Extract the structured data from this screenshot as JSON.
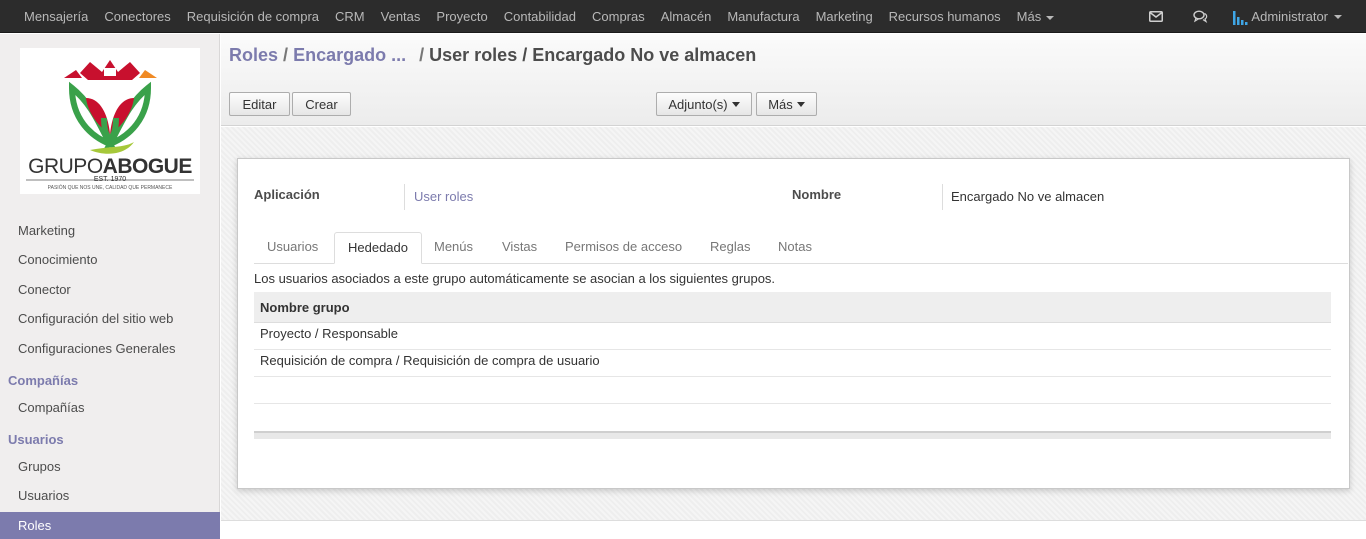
{
  "topnav": {
    "items": [
      "Mensajería",
      "Conectores",
      "Requisición de compra",
      "CRM",
      "Ventas",
      "Proyecto",
      "Contabilidad",
      "Compras",
      "Almacén",
      "Manufactura",
      "Marketing",
      "Recursos humanos"
    ],
    "more_label": "Más",
    "user_name": "Administrator",
    "icons": [
      "envelope-icon",
      "chat-icon",
      "user-avatar-icon"
    ]
  },
  "logo": {
    "brand_left": "GRUPO",
    "brand_right": "ABOGUE",
    "est": "EST. 1970",
    "tagline": "PASIÓN QUE NOS UNE, CALIDAD QUE PERMANECE",
    "colors": {
      "green": "#3aa14a",
      "red": "#c8102e",
      "orange": "#f08a24"
    }
  },
  "sidebar": {
    "items_top": [
      "Marketing",
      "Conocimiento",
      "Conector",
      "Configuración del sitio web",
      "Configuraciones Generales"
    ],
    "heading_companies": "Compañías",
    "companies": [
      "Compañías"
    ],
    "heading_users": "Usuarios",
    "users": [
      "Grupos",
      "Usuarios"
    ],
    "active_item": "Roles"
  },
  "breadcrumb": {
    "root": "Roles",
    "parent": "Encargado ...",
    "current": "User roles / Encargado No ve almacen"
  },
  "toolbar": {
    "edit_label": "Editar",
    "create_label": "Crear",
    "attachments_label": "Adjunto(s)",
    "more_label": "Más"
  },
  "form": {
    "application_label": "Aplicación",
    "application_value": "User roles",
    "name_label": "Nombre",
    "name_value": "Encargado No ve almacen"
  },
  "tabs": [
    "Usuarios",
    "Hededado",
    "Menús",
    "Vistas",
    "Permisos de acceso",
    "Reglas",
    "Notas"
  ],
  "active_tab": "Hededado",
  "inherited": {
    "note": "Los usuarios asociados a este grupo automáticamente se asocian a los siguientes grupos.",
    "column_header": "Nombre grupo",
    "rows": [
      "Proyecto / Responsable",
      "Requisición de compra / Requisición de compra de usuario"
    ]
  },
  "colors": {
    "accent": "#7c7bad",
    "topbar": "#2c2c2c",
    "sidebar": "#f0eeee"
  }
}
